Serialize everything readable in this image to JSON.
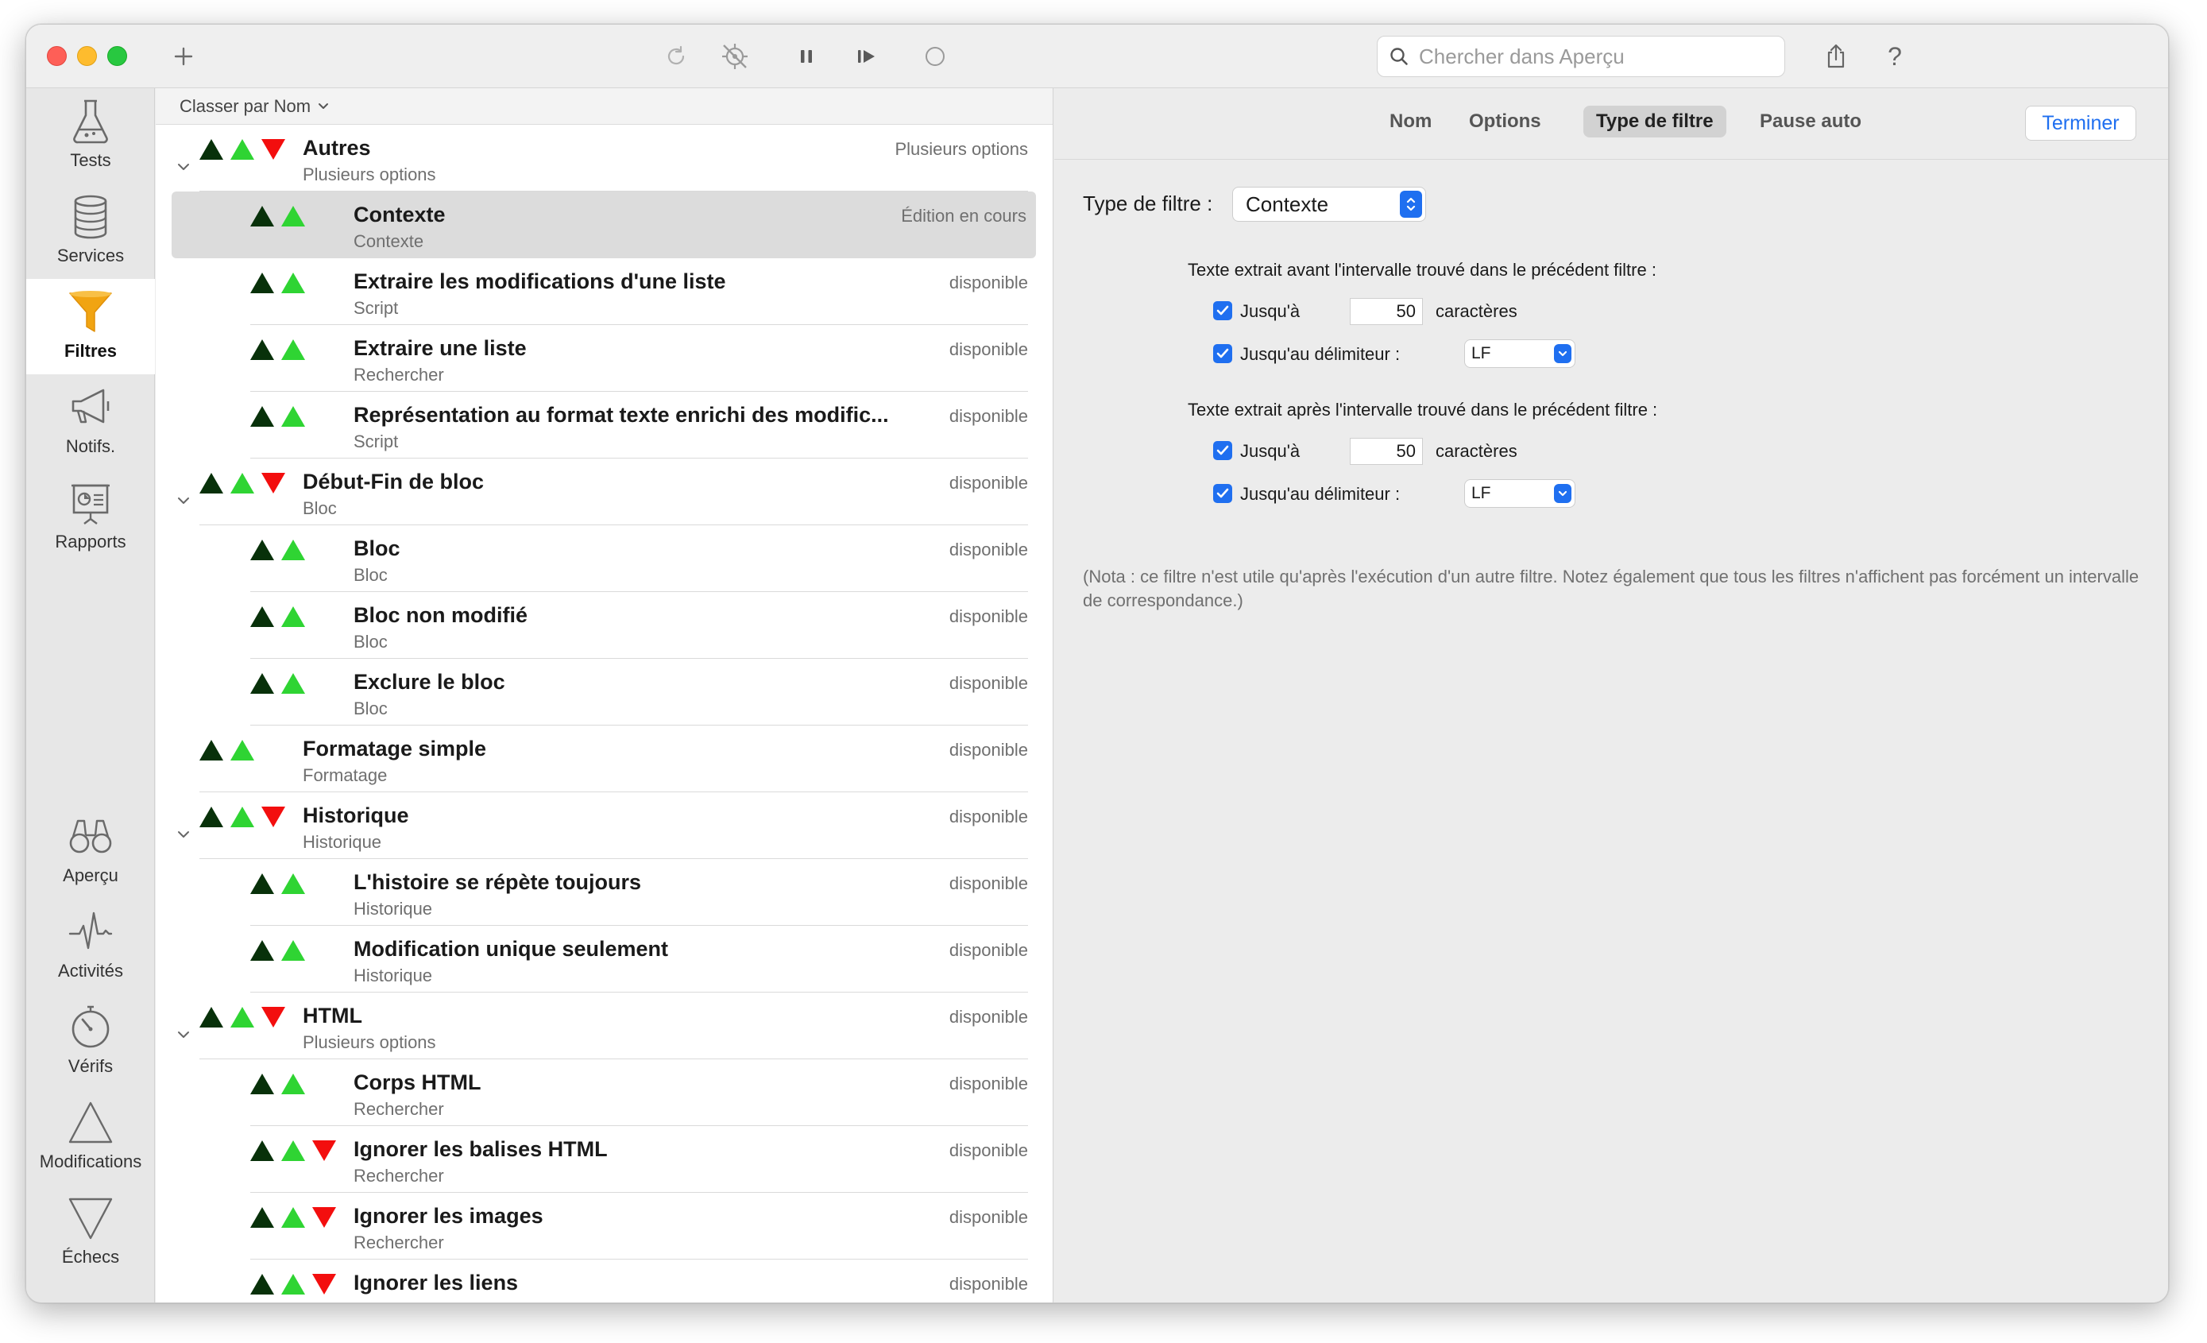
{
  "toolbar": {
    "search_placeholder": "Chercher dans Aperçu"
  },
  "sidebar": {
    "top_items": [
      {
        "label": "Tests",
        "icon": "flask-icon"
      },
      {
        "label": "Services",
        "icon": "database-icon"
      },
      {
        "label": "Filtres",
        "icon": "funnel-icon",
        "active": true
      },
      {
        "label": "Notifs.",
        "icon": "megaphone-icon"
      },
      {
        "label": "Rapports",
        "icon": "report-icon"
      }
    ],
    "bottom_items": [
      {
        "label": "Aperçu",
        "icon": "binoculars-icon"
      },
      {
        "label": "Activités",
        "icon": "pulse-icon"
      },
      {
        "label": "Vérifs",
        "icon": "stopwatch-icon"
      },
      {
        "label": "Modifications",
        "icon": "triangle-up-icon"
      },
      {
        "label": "Échecs",
        "icon": "triangle-down-icon"
      }
    ]
  },
  "list": {
    "sort_label": "Classer par Nom",
    "rows": [
      {
        "title": "Autres",
        "subtitle": "Plusieurs options",
        "status": "Plusieurs options",
        "level": 0,
        "arrows": "ud",
        "expandable": true
      },
      {
        "title": "Contexte",
        "subtitle": "Contexte",
        "status": "Édition en cours",
        "level": 1,
        "arrows": "u",
        "selected": true
      },
      {
        "title": "Extraire les modifications d'une liste",
        "subtitle": "Script",
        "status": "disponible",
        "level": 1,
        "arrows": "u"
      },
      {
        "title": "Extraire une liste",
        "subtitle": "Rechercher",
        "status": "disponible",
        "level": 1,
        "arrows": "u"
      },
      {
        "title": "Représentation au format texte enrichi des modific...",
        "subtitle": "Script",
        "status": "disponible",
        "level": 1,
        "arrows": "u"
      },
      {
        "title": "Début-Fin de bloc",
        "subtitle": "Bloc",
        "status": "disponible",
        "level": 0,
        "arrows": "ud",
        "expandable": true
      },
      {
        "title": "Bloc",
        "subtitle": "Bloc",
        "status": "disponible",
        "level": 1,
        "arrows": "u"
      },
      {
        "title": "Bloc non modifié",
        "subtitle": "Bloc",
        "status": "disponible",
        "level": 1,
        "arrows": "u"
      },
      {
        "title": "Exclure le bloc",
        "subtitle": "Bloc",
        "status": "disponible",
        "level": 1,
        "arrows": "u"
      },
      {
        "title": "Formatage simple",
        "subtitle": "Formatage",
        "status": "disponible",
        "level": 0,
        "arrows": "u"
      },
      {
        "title": "Historique",
        "subtitle": "Historique",
        "status": "disponible",
        "level": 0,
        "arrows": "ud",
        "expandable": true
      },
      {
        "title": "L'histoire se répète toujours",
        "subtitle": "Historique",
        "status": "disponible",
        "level": 1,
        "arrows": "u"
      },
      {
        "title": "Modification unique seulement",
        "subtitle": "Historique",
        "status": "disponible",
        "level": 1,
        "arrows": "u"
      },
      {
        "title": "HTML",
        "subtitle": "Plusieurs options",
        "status": "disponible",
        "level": 0,
        "arrows": "ud",
        "expandable": true
      },
      {
        "title": "Corps HTML",
        "subtitle": "Rechercher",
        "status": "disponible",
        "level": 1,
        "arrows": "u"
      },
      {
        "title": "Ignorer les balises HTML",
        "subtitle": "Rechercher",
        "status": "disponible",
        "level": 1,
        "arrows": "ud"
      },
      {
        "title": "Ignorer les images",
        "subtitle": "Rechercher",
        "status": "disponible",
        "level": 1,
        "arrows": "ud"
      },
      {
        "title": "Ignorer les liens",
        "subtitle": "",
        "status": "disponible",
        "level": 1,
        "arrows": "ud"
      }
    ]
  },
  "detail": {
    "tabs": [
      "Nom",
      "Options",
      "Type de filtre",
      "Pause auto"
    ],
    "active_tab": "Type de filtre",
    "done_label": "Terminer",
    "filter_type_label": "Type de filtre :",
    "filter_type_value": "Contexte",
    "before": {
      "title": "Texte extrait avant l'intervalle trouvé dans le précédent filtre :",
      "upto_label": "Jusqu'à",
      "upto_value": "50",
      "chars_label": "caractères",
      "delim_label": "Jusqu'au délimiteur :",
      "delim_value": "LF"
    },
    "after": {
      "title": "Texte extrait après l'intervalle trouvé dans le précédent filtre :",
      "upto_label": "Jusqu'à",
      "upto_value": "50",
      "chars_label": "caractères",
      "delim_label": "Jusqu'au délimiteur :",
      "delim_value": "LF"
    },
    "note": "(Nota : ce filtre n'est utile qu'après l'exécution d'un autre filtre. Notez également que tous les filtres n'affichent pas forcément un intervalle de correspondance.)"
  },
  "colors": {
    "accent": "#1f6ff0",
    "arrow_dark_green": "#08310a",
    "arrow_green": "#2fd433",
    "arrow_red": "#f30e0e"
  }
}
